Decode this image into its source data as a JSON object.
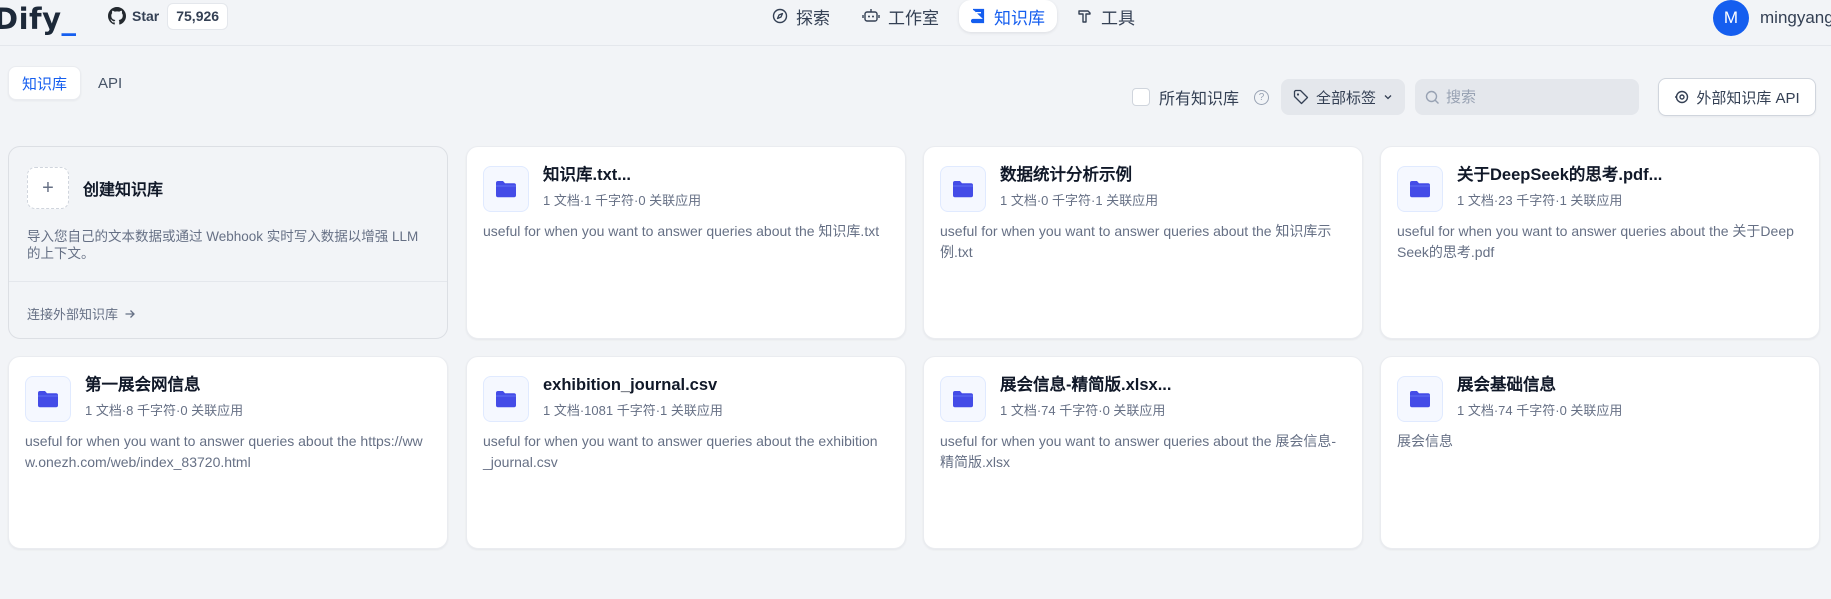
{
  "header": {
    "logo": "Dify",
    "logo_dot": "_",
    "github": {
      "star_label": "Star",
      "star_count": "75,926"
    },
    "nav": [
      {
        "label": "探索",
        "icon": "compass-icon",
        "active": false
      },
      {
        "label": "工作室",
        "icon": "robot-icon",
        "active": false
      },
      {
        "label": "知识库",
        "icon": "book-icon",
        "active": true
      },
      {
        "label": "工具",
        "icon": "hammer-icon",
        "active": false
      }
    ],
    "user": {
      "avatar_initial": "M",
      "name": "mingyang"
    }
  },
  "toolbar": {
    "tabs": [
      {
        "label": "知识库",
        "active": true
      },
      {
        "label": "API",
        "active": false
      }
    ],
    "all_datasets_label": "所有知识库",
    "tag_filter_label": "全部标签",
    "search_placeholder": "搜索",
    "external_api_label": "外部知识库 API"
  },
  "create_card": {
    "title": "创建知识库",
    "description": "导入您自己的文本数据或通过 Webhook 实时写入数据以增强 LLM 的上下文。",
    "link_label": "连接外部知识库"
  },
  "datasets": [
    {
      "title": "知识库.txt...",
      "meta": "1 文档·1 千字符·0 关联应用",
      "description": "useful for when you want to answer queries about the 知识库.txt"
    },
    {
      "title": "数据统计分析示例",
      "meta": "1 文档·0 千字符·1 关联应用",
      "description": "useful for when you want to answer queries about the 知识库示例.txt"
    },
    {
      "title": "关于DeepSeek的思考.pdf...",
      "meta": "1 文档·23 千字符·1 关联应用",
      "description": "useful for when you want to answer queries about the 关于DeepSeek的思考.pdf"
    },
    {
      "title": "第一展会网信息",
      "meta": "1 文档·8 千字符·0 关联应用",
      "description": "useful for when you want to answer queries about the https://www.onezh.com/web/index_83720.html"
    },
    {
      "title": "exhibition_journal.csv",
      "meta": "1 文档·1081 千字符·1 关联应用",
      "description": "useful for when you want to answer queries about the exhibition_journal.csv"
    },
    {
      "title": "展会信息-精简版.xlsx...",
      "meta": "1 文档·74 千字符·0 关联应用",
      "description": "useful for when you want to answer queries about the 展会信息-精简版.xlsx"
    },
    {
      "title": "展会基础信息",
      "meta": "1 文档·74 千字符·0 关联应用",
      "description": "展会信息"
    }
  ],
  "colors": {
    "accent": "#155eef",
    "folder_icon": "#444ce7",
    "background": "#f2f4f7"
  }
}
